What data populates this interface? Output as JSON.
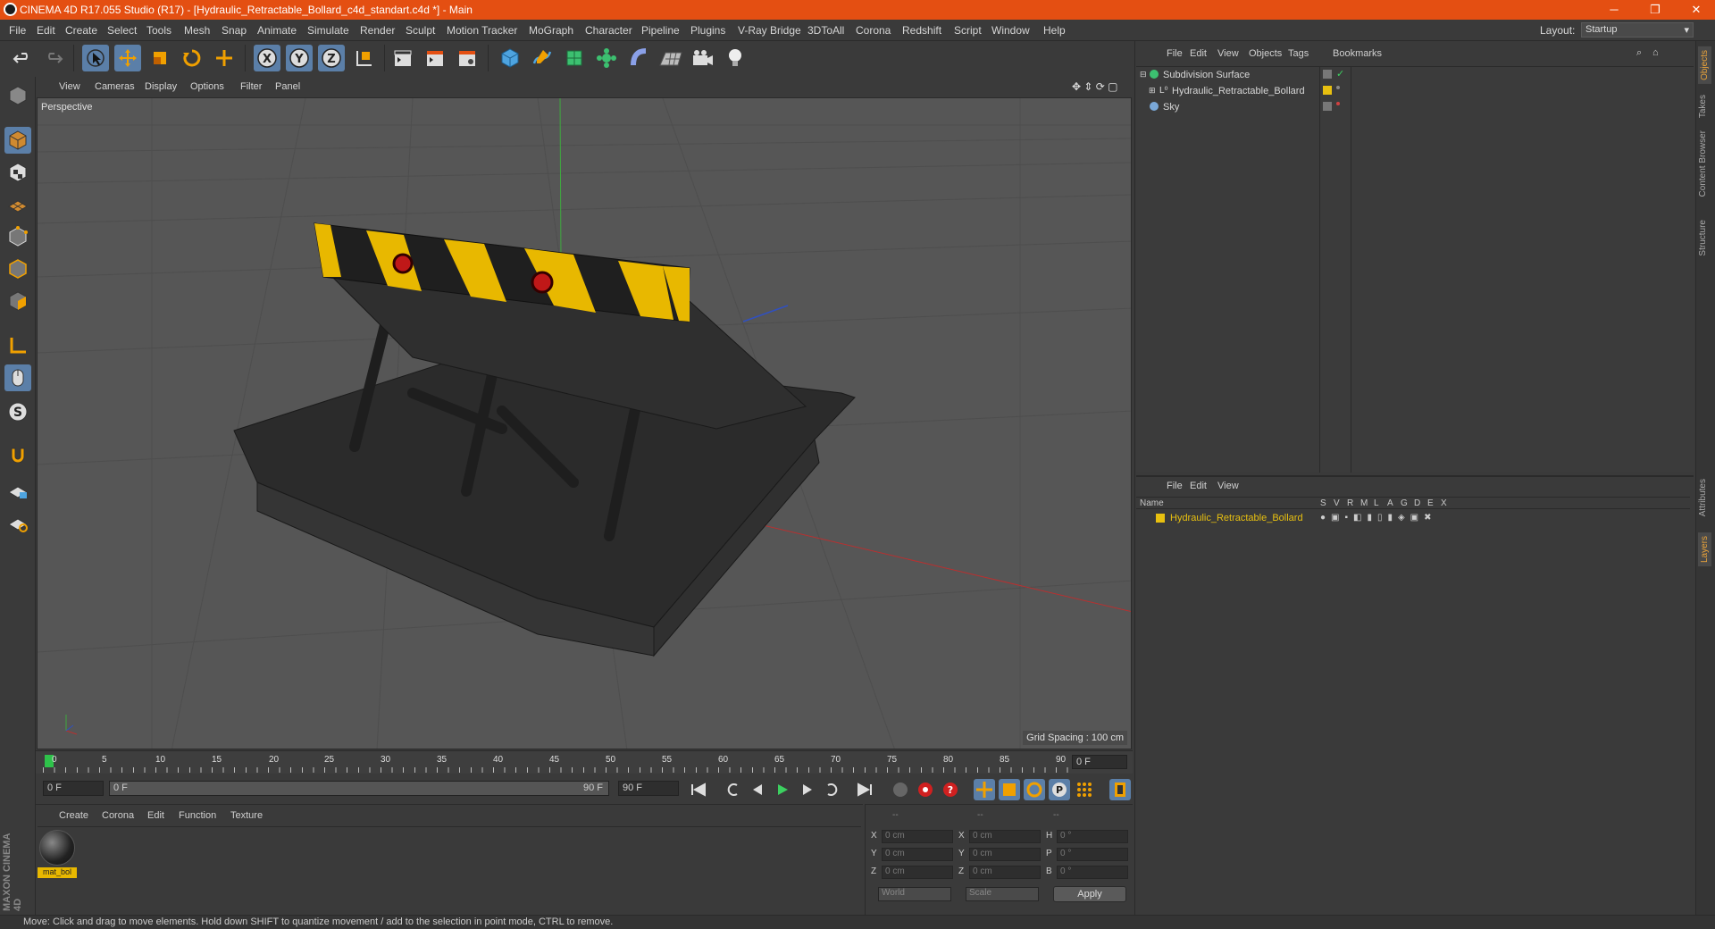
{
  "window": {
    "title": "CINEMA 4D R17.055 Studio (R17) - [Hydraulic_Retractable_Bollard_c4d_standart.c4d *] - Main",
    "minimize": "─",
    "maximize": "❐",
    "close": "✕"
  },
  "menu": [
    "File",
    "Edit",
    "Create",
    "Select",
    "Tools",
    "Mesh",
    "Snap",
    "Animate",
    "Simulate",
    "Render",
    "Sculpt",
    "Motion Tracker",
    "MoGraph",
    "Character",
    "Pipeline",
    "Plugins",
    "V-Ray Bridge",
    "3DToAll",
    "Corona",
    "Redshift",
    "Script",
    "Window",
    "Help"
  ],
  "layout": {
    "label": "Layout:",
    "value": "Startup"
  },
  "viewport": {
    "menu": [
      "View",
      "Cameras",
      "Display",
      "Options",
      "Filter",
      "Panel"
    ],
    "label": "Perspective",
    "grid_spacing": "Grid Spacing : 100 cm"
  },
  "timeline": {
    "ticks": [
      "0",
      "5",
      "10",
      "15",
      "20",
      "25",
      "30",
      "35",
      "40",
      "45",
      "50",
      "55",
      "60",
      "65",
      "70",
      "75",
      "80",
      "85",
      "90"
    ],
    "end_field": "0 F"
  },
  "playback": {
    "start": "0 F",
    "range_start": "0 F",
    "range_end": "90 F",
    "end": "90 F"
  },
  "material_manager": {
    "menu": [
      "Create",
      "Corona",
      "Edit",
      "Function",
      "Texture"
    ],
    "materials": [
      {
        "name": "mat_bol"
      }
    ],
    "brand": "MAXON CINEMA 4D"
  },
  "coordinates": {
    "headers": [
      "--",
      "--",
      "--"
    ],
    "rows": [
      {
        "a": "X",
        "av": "0 cm",
        "b": "X",
        "bv": "0 cm",
        "c": "H",
        "cv": "0 °"
      },
      {
        "a": "Y",
        "av": "0 cm",
        "b": "Y",
        "bv": "0 cm",
        "c": "P",
        "cv": "0 °"
      },
      {
        "a": "Z",
        "av": "0 cm",
        "b": "Z",
        "bv": "0 cm",
        "c": "B",
        "cv": "0 °"
      }
    ],
    "mode1": "World",
    "mode2": "Scale",
    "apply": "Apply"
  },
  "object_manager": {
    "menu": [
      "File",
      "Edit",
      "View",
      "Objects",
      "Tags",
      "Bookmarks"
    ],
    "objects": [
      {
        "name": "Subdivision Surface",
        "color": "#d8d8d8"
      },
      {
        "name": "Hydraulic_Retractable_Bollard",
        "color": "#d8d8d8"
      },
      {
        "name": "Sky",
        "color": "#d8d8d8"
      }
    ]
  },
  "layer_manager": {
    "menu": [
      "File",
      "Edit",
      "View"
    ],
    "header_name": "Name",
    "columns": [
      "S",
      "V",
      "R",
      "M",
      "L",
      "A",
      "G",
      "D",
      "E",
      "X"
    ],
    "layers": [
      {
        "name": "Hydraulic_Retractable_Bollard",
        "color": "#e8c010"
      }
    ]
  },
  "side_tabs": [
    "Objects",
    "Takes",
    "Content Browser",
    "Structure"
  ],
  "side_tabs_lower": [
    "Attributes",
    "Layers"
  ],
  "status": "Move: Click and drag to move elements. Hold down SHIFT to quantize movement / add to the selection in point mode, CTRL to remove.",
  "colors": {
    "accent": "#e44f12",
    "selection": "#5b7fa8",
    "layer_yellow": "#e8c010"
  }
}
